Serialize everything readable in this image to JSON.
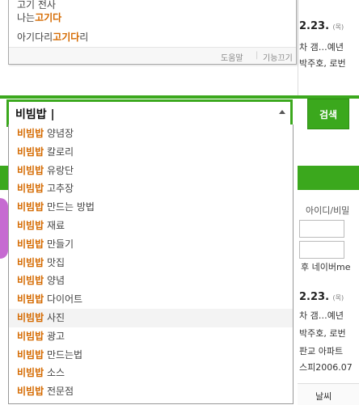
{
  "top_dropdown": {
    "row0_prefix": "",
    "row0_bold": "",
    "row0_rest": "고기 전사",
    "row1_prefix": "나는",
    "row1_bold": "고기다",
    "row1_rest": "",
    "row2_prefix": "아기다리",
    "row2_bold": "고기다",
    "row2_rest": "리",
    "help": "도움말",
    "sep": "|",
    "off": "기능끄기"
  },
  "search": {
    "value": "비빔밥 |",
    "button": "검색"
  },
  "suggestions": [
    {
      "bold": "비빔밥",
      "rest": " 양념장"
    },
    {
      "bold": "비빔밥",
      "rest": " 칼로리"
    },
    {
      "bold": "비빔밥",
      "rest": " 유랑단"
    },
    {
      "bold": "비빔밥",
      "rest": " 고추장"
    },
    {
      "bold": "비빔밥",
      "rest": " 만드는 방법"
    },
    {
      "bold": "비빔밥",
      "rest": " 재료"
    },
    {
      "bold": "비빔밥",
      "rest": " 만들기"
    },
    {
      "bold": "비빔밥",
      "rest": " 맛집"
    },
    {
      "bold": "비빔밥",
      "rest": " 양념"
    },
    {
      "bold": "비빔밥",
      "rest": " 다이어트"
    },
    {
      "bold": "비빔밥",
      "rest": " 사진"
    },
    {
      "bold": "비빔밥",
      "rest": " 광고"
    },
    {
      "bold": "비빔밥",
      "rest": " 만드는법"
    },
    {
      "bold": "비빔밥",
      "rest": " 소스"
    },
    {
      "bold": "비빔밥",
      "rest": " 전문점"
    }
  ],
  "highlighted_index": 10,
  "right_column": {
    "date1": "2.23.",
    "date1_small": "(목)",
    "line1a": "차 갬…예년",
    "line1b": "박주호, 로번",
    "id_text": "아이디/비밀",
    "naverme": "후 네이버me",
    "date2": "2.23.",
    "date2_small": "(목)",
    "line2a": "차 갬…예년",
    "line2b": "박주호, 로번",
    "line2c": "판교 아파트",
    "line2d": "스피2006.07",
    "weather": "날씨"
  },
  "colors": {
    "green": "#3ba81d",
    "orange": "#d56a00"
  }
}
